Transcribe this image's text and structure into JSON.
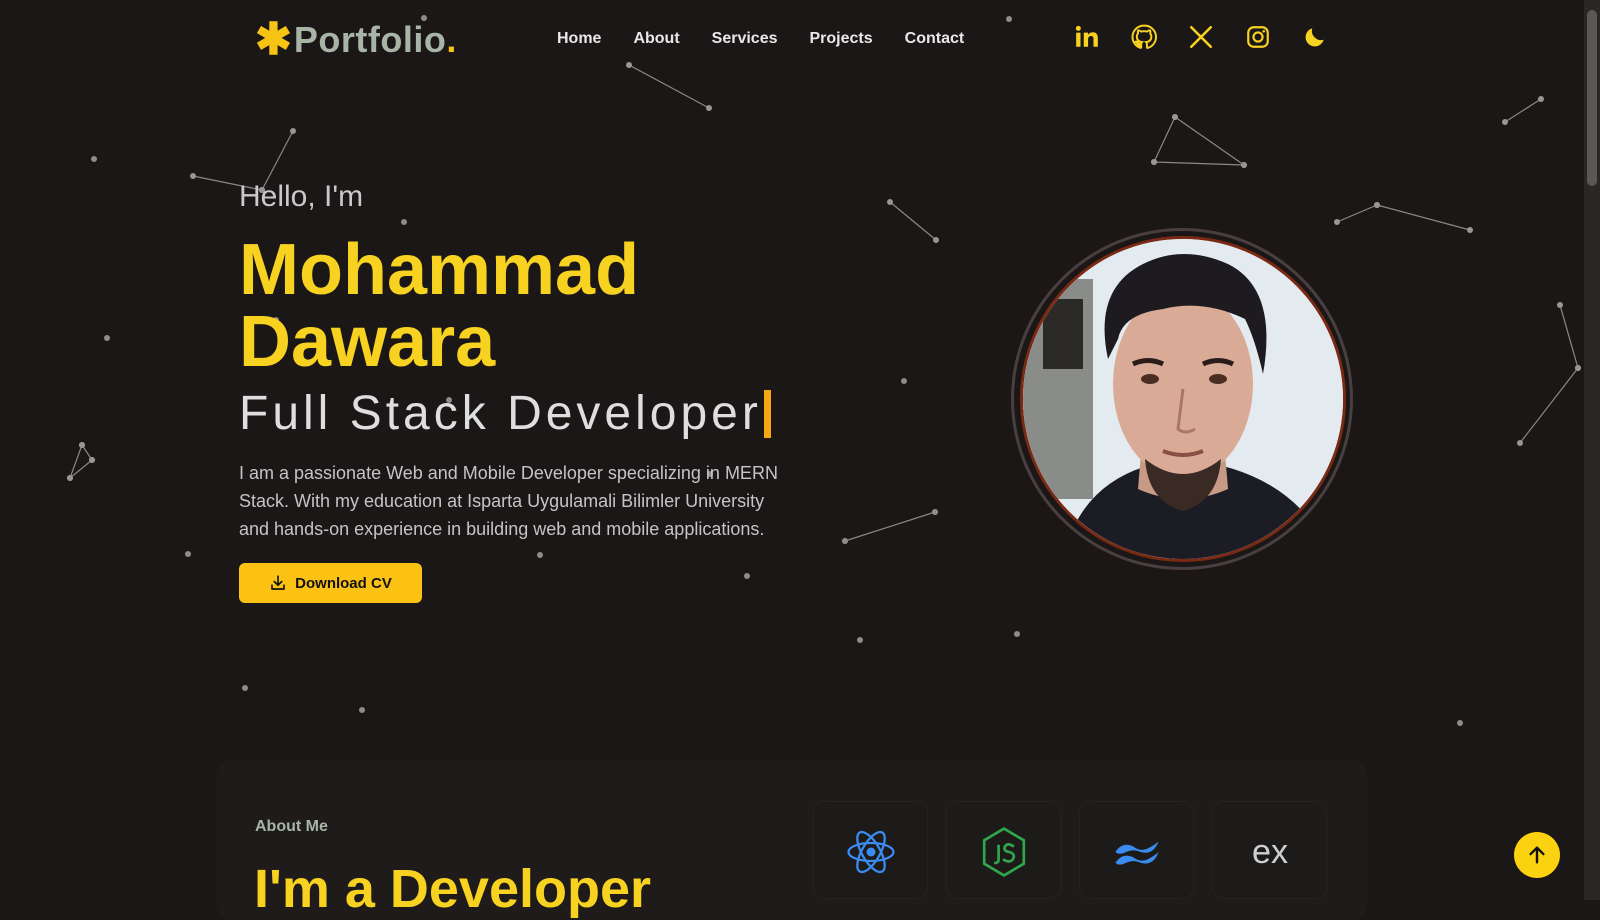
{
  "brand": {
    "symbol": "✱",
    "name": "Portfolio",
    "dot": "."
  },
  "nav": {
    "items": [
      "Home",
      "About",
      "Services",
      "Projects",
      "Contact"
    ]
  },
  "socials": [
    "linkedin-icon",
    "github-icon",
    "x-icon",
    "instagram-icon",
    "moon-icon"
  ],
  "hero": {
    "greeting": "Hello, I'm",
    "first_name": "Mohammad",
    "last_name": "Dawara",
    "role": "Full Stack Developer",
    "bio": "I am a passionate Web and Mobile Developer specializing in MERN Stack. With my education at Isparta Uygulamali Bilimler University and hands-on experience in building web and mobile applications.",
    "download_label": "Download CV"
  },
  "about": {
    "label": "About Me",
    "title": "I'm a Developer",
    "tech": [
      "react-icon",
      "nodejs-icon",
      "tailwind-icon",
      "express-icon"
    ],
    "tech_express_text": "ex"
  },
  "colors": {
    "accent": "#f7d221",
    "button": "#fbc213",
    "background": "#1b1717",
    "brand_text": "#a8b4a6"
  }
}
